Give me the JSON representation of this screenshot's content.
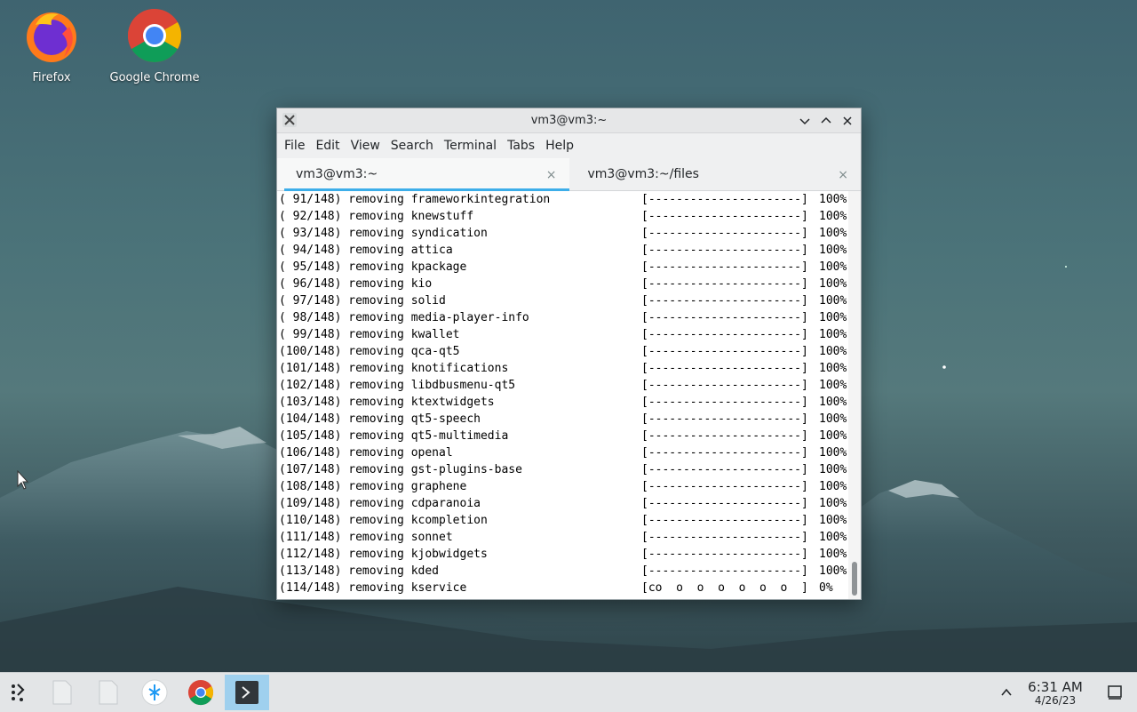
{
  "desktop": {
    "icons": [
      {
        "label": "Firefox"
      },
      {
        "label": "Google Chrome"
      }
    ]
  },
  "window": {
    "title": "vm3@vm3:~",
    "menu": [
      "File",
      "Edit",
      "View",
      "Search",
      "Terminal",
      "Tabs",
      "Help"
    ],
    "tabs": [
      {
        "label": "vm3@vm3:~",
        "close": "×"
      },
      {
        "label": "vm3@vm3:~/files",
        "close": "×"
      }
    ],
    "terminal_lines": [
      {
        "text": "( 91/148) removing frameworkintegration",
        "bar": "[----------------------]",
        "pct": "100%"
      },
      {
        "text": "( 92/148) removing knewstuff",
        "bar": "[----------------------]",
        "pct": "100%"
      },
      {
        "text": "( 93/148) removing syndication",
        "bar": "[----------------------]",
        "pct": "100%"
      },
      {
        "text": "( 94/148) removing attica",
        "bar": "[----------------------]",
        "pct": "100%"
      },
      {
        "text": "( 95/148) removing kpackage",
        "bar": "[----------------------]",
        "pct": "100%"
      },
      {
        "text": "( 96/148) removing kio",
        "bar": "[----------------------]",
        "pct": "100%"
      },
      {
        "text": "( 97/148) removing solid",
        "bar": "[----------------------]",
        "pct": "100%"
      },
      {
        "text": "( 98/148) removing media-player-info",
        "bar": "[----------------------]",
        "pct": "100%"
      },
      {
        "text": "( 99/148) removing kwallet",
        "bar": "[----------------------]",
        "pct": "100%"
      },
      {
        "text": "(100/148) removing qca-qt5",
        "bar": "[----------------------]",
        "pct": "100%"
      },
      {
        "text": "(101/148) removing knotifications",
        "bar": "[----------------------]",
        "pct": "100%"
      },
      {
        "text": "(102/148) removing libdbusmenu-qt5",
        "bar": "[----------------------]",
        "pct": "100%"
      },
      {
        "text": "(103/148) removing ktextwidgets",
        "bar": "[----------------------]",
        "pct": "100%"
      },
      {
        "text": "(104/148) removing qt5-speech",
        "bar": "[----------------------]",
        "pct": "100%"
      },
      {
        "text": "(105/148) removing qt5-multimedia",
        "bar": "[----------------------]",
        "pct": "100%"
      },
      {
        "text": "(106/148) removing openal",
        "bar": "[----------------------]",
        "pct": "100%"
      },
      {
        "text": "(107/148) removing gst-plugins-base",
        "bar": "[----------------------]",
        "pct": "100%"
      },
      {
        "text": "(108/148) removing graphene",
        "bar": "[----------------------]",
        "pct": "100%"
      },
      {
        "text": "(109/148) removing cdparanoia",
        "bar": "[----------------------]",
        "pct": "100%"
      },
      {
        "text": "(110/148) removing kcompletion",
        "bar": "[----------------------]",
        "pct": "100%"
      },
      {
        "text": "(111/148) removing sonnet",
        "bar": "[----------------------]",
        "pct": "100%"
      },
      {
        "text": "(112/148) removing kjobwidgets",
        "bar": "[----------------------]",
        "pct": "100%"
      },
      {
        "text": "(113/148) removing kded",
        "bar": "[----------------------]",
        "pct": "100%"
      },
      {
        "text": "(114/148) removing kservice",
        "bar": "[co  o  o  o  o  o  o  ]",
        "pct": "0%"
      }
    ]
  },
  "taskbar": {
    "clock_time": "6:31 AM",
    "clock_date": "4/26/23"
  }
}
